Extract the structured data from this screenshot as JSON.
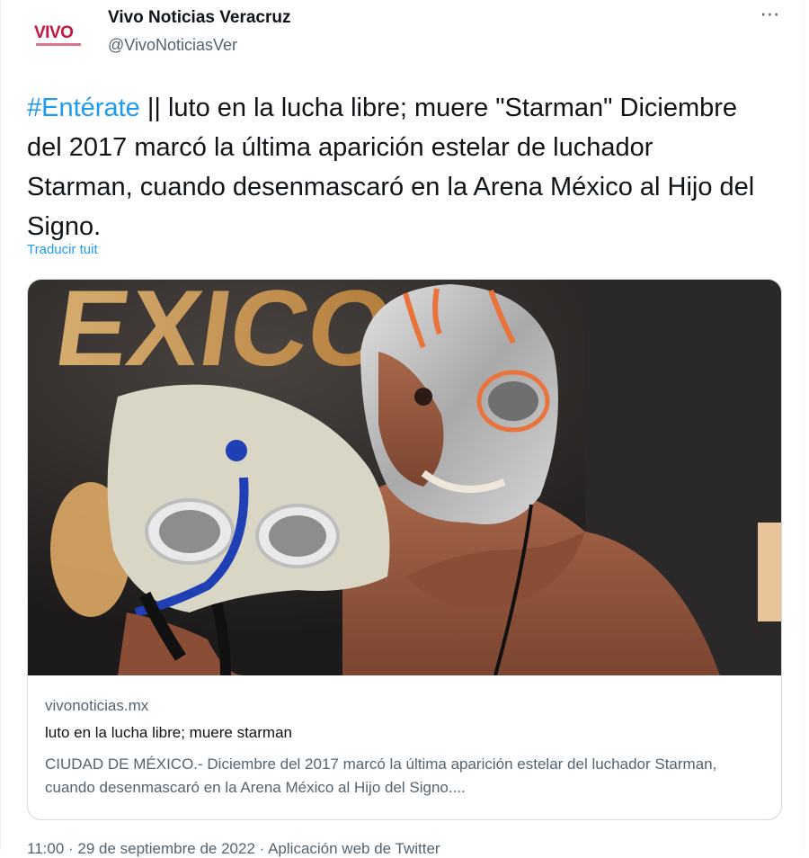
{
  "author": {
    "name": "Vivo Noticias Veracruz",
    "handle": "@VivoNoticiasVer",
    "avatar_logo": "VIVO"
  },
  "more_icon": "more-horizontal-icon",
  "tweet": {
    "hashtag": "#Entérate",
    "text": " || luto en la lucha libre; muere \"Starman\" Diciembre del 2017 marcó la última aparición estelar de luchador Starman, cuando desenmascaró en la Arena México al Hijo del Signo.",
    "translate_label": "Traducir tuit"
  },
  "card": {
    "domain": "vivonoticias.mx",
    "title": "luto en la lucha libre; muere starman",
    "description": "CIUDAD DE MÉXICO.- Diciembre del 2017 marcó la última aparición estelar del luchador Starman, cuando desenmascaró en la Arena México al Hijo del Signo...."
  },
  "footer": {
    "meta": "11:00 · 29 de septiembre de 2022 · Aplicación web de Twitter"
  },
  "colors": {
    "link": "#1d9bf0",
    "text": "#0f1419",
    "secondary": "#536471",
    "brand": "#c4163f"
  }
}
